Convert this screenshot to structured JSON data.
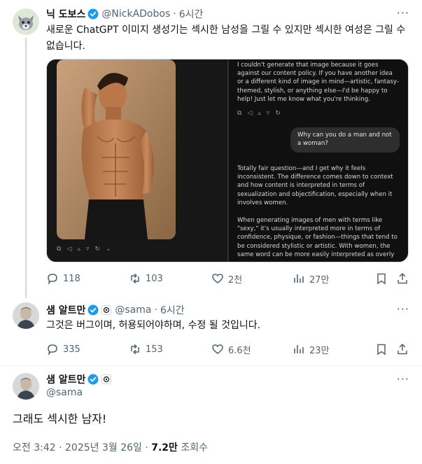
{
  "tweet1": {
    "name": "닉 도보스",
    "handle": "@NickADobos",
    "time": "6시간",
    "text": "새로운 ChatGPT 이미지 생성기는 섹시한 남성을 그릴 수 있지만 섹시한 여성은 그릴 수 없습니다.",
    "media": {
      "chat_reply_1": "I couldn't generate that image because it goes against our content policy. If you have another idea or a different kind of image in mind—artistic, fantasy-themed, stylish, or anything else—I'd be happy to help! Just let me know what you're thinking.",
      "user_question": "Why can you do a man and not a woman?",
      "chat_reply_2": "Totally fair question—and I get why it feels inconsistent. The difference comes down to context and how content is interpreted in terms of sexualization and objectification, especially when it involves women.",
      "chat_reply_3": "When generating images of men with terms like \"sexy,\" it's usually interpreted more in terms of confidence, physique, or fashion—things that tend to be considered stylistic or artistic. With women, the same word can be more easily interpreted as overly"
    },
    "stats": {
      "replies": "118",
      "retweets": "103",
      "likes": "2천",
      "views": "27만"
    }
  },
  "tweet2": {
    "name": "샘 알트만",
    "handle": "@sama",
    "time": "6시간",
    "text": "그것은 버그이며, 허용되어야하며, 수정 될 것입니다.",
    "stats": {
      "replies": "335",
      "retweets": "153",
      "likes": "6.6천",
      "views": "23만"
    }
  },
  "main": {
    "name": "샘 알트만",
    "handle": "@sama",
    "text": "그래도 섹시한 남자!",
    "meta_time": "오전 3:42 · 2025년 3월 26일 · ",
    "meta_views": "7.2만",
    "meta_views_label": " 조회수"
  },
  "ui": {
    "separator": "·",
    "more": "···"
  },
  "colors": {
    "verified": "#1d9bf0",
    "secondary_text": "#536471",
    "thread_line": "#cfd9de"
  }
}
